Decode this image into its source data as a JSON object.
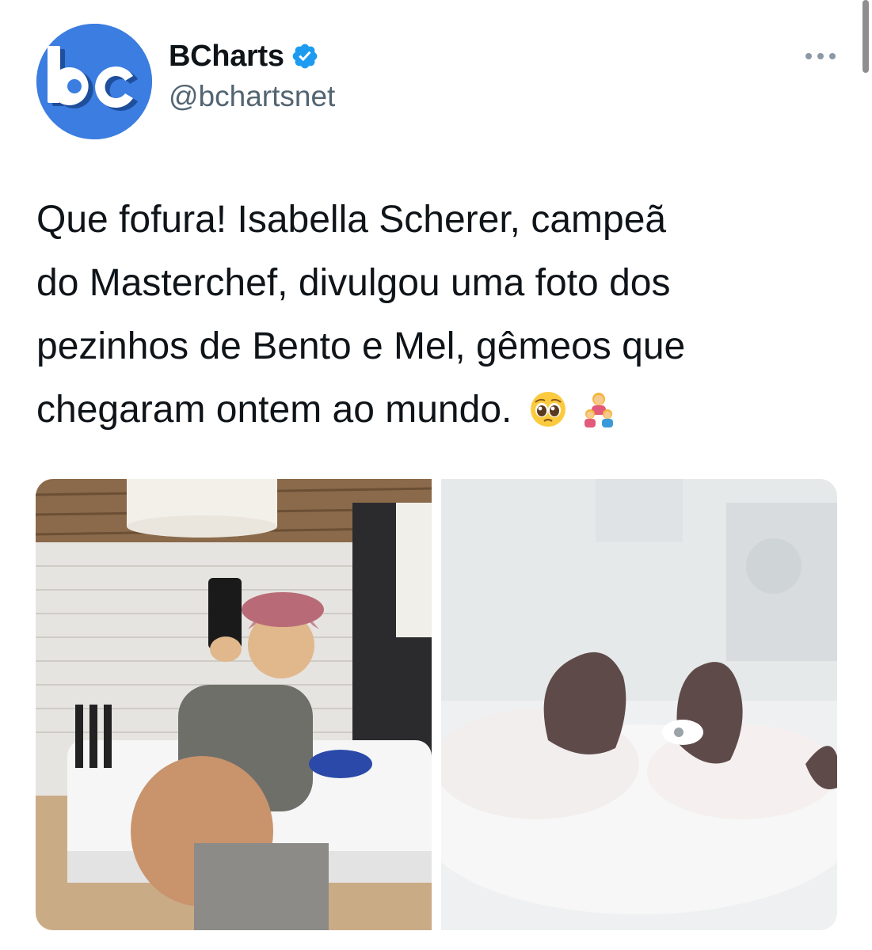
{
  "tweet": {
    "author": {
      "display_name": "BCharts",
      "handle": "@bchartsnet",
      "avatar_text": "bc",
      "verified": true
    },
    "text": "Que fofura! Isabella Scherer, campeã\ndo Masterchef, divulgou uma foto dos\npezinhos de Bento e Mel, gêmeos que\nchegaram ontem ao mundo.",
    "emojis": [
      "pleading-face",
      "family-mother-children"
    ],
    "media": [
      {
        "name": "selfie-photo",
        "icon": "image"
      },
      {
        "name": "baby-feet-photo",
        "icon": "image"
      }
    ]
  },
  "colors": {
    "avatar_bg": "#3b7de0",
    "verified": "#1d9bf0",
    "secondary_text": "#536471",
    "primary_text": "#0f1419"
  }
}
